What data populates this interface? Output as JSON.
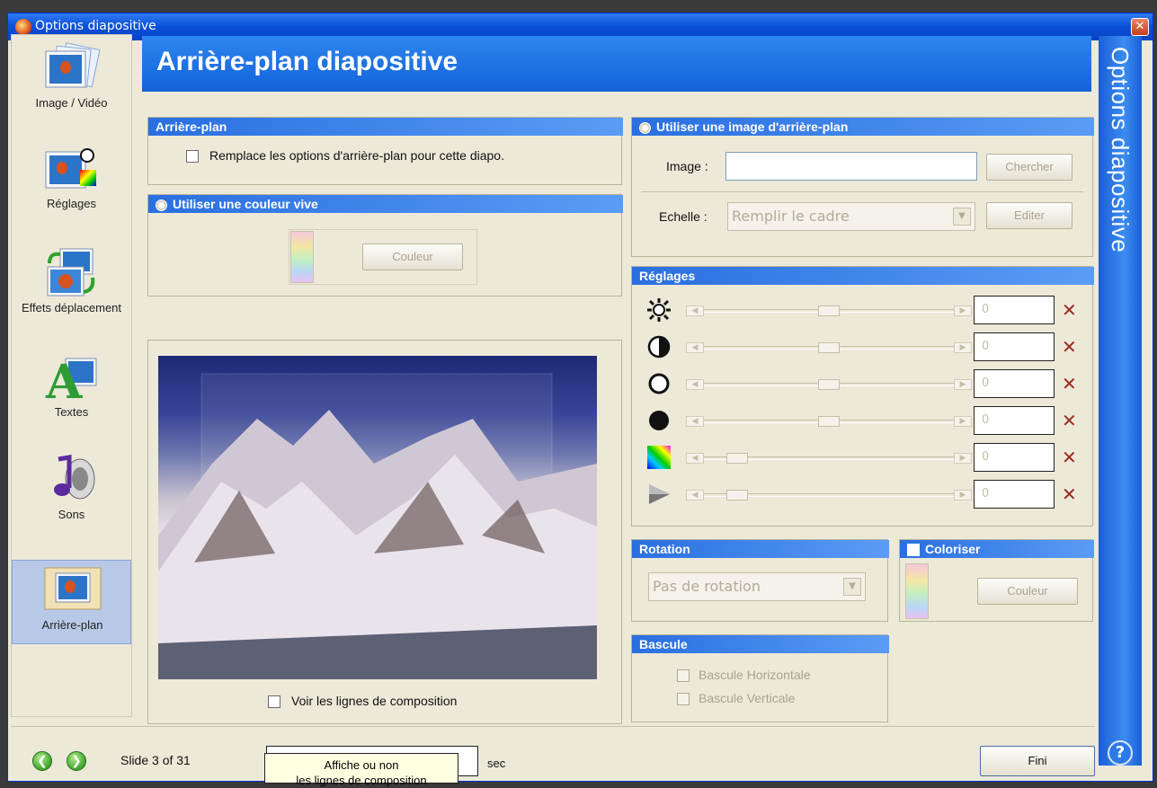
{
  "window": {
    "title": "Options diapositive",
    "close": "✕"
  },
  "header": {
    "title": "Arrière-plan diapositive"
  },
  "side_title": "Options diapositive",
  "help": "?",
  "sidebar": {
    "items": [
      {
        "label": "Image / Vidéo",
        "icon": "image-stack-icon"
      },
      {
        "label": "Réglages",
        "icon": "image-settings-icon"
      },
      {
        "label": "Effets déplacement",
        "icon": "motion-effects-icon"
      },
      {
        "label": "Textes",
        "icon": "text-letter-icon"
      },
      {
        "label": "Sons",
        "icon": "music-note-speaker-icon"
      },
      {
        "label": "Arrière-plan",
        "icon": "background-image-icon",
        "active": true
      }
    ]
  },
  "arriere_plan": {
    "title": "Arrière-plan",
    "override_label": "Remplace les options d'arrière-plan pour cette diapo.",
    "override_checked": false
  },
  "couleur_vive": {
    "title": "Utiliser une couleur vive",
    "button": "Couleur"
  },
  "image_bg": {
    "title": "Utiliser une image d'arrière-plan",
    "image_label": "Image :",
    "image_value": "",
    "browse_button": "Chercher",
    "scale_label": "Echelle :",
    "scale_value": "Remplir le cadre",
    "edit_button": "Editer"
  },
  "reglages": {
    "title": "Réglages",
    "rows": [
      {
        "icon": "brightness-icon",
        "value": "0",
        "position": 0.5
      },
      {
        "icon": "contrast-icon",
        "value": "0",
        "position": 0.5
      },
      {
        "icon": "white-point-icon",
        "value": "0",
        "position": 0.5
      },
      {
        "icon": "black-point-icon",
        "value": "0",
        "position": 0.5
      },
      {
        "icon": "color-spectrum-icon",
        "value": "0",
        "position": 0.1
      },
      {
        "icon": "transparency-icon",
        "value": "0",
        "position": 0.1
      }
    ],
    "reset": "✕"
  },
  "rotation": {
    "title": "Rotation",
    "value": "Pas de rotation"
  },
  "coloriser": {
    "title": "Coloriser",
    "button": "Couleur"
  },
  "bascule": {
    "title": "Bascule",
    "horizontal": "Bascule Horizontale",
    "vertical": "Bascule Verticale"
  },
  "preview": {
    "grid_label": "Voir les lignes de composition"
  },
  "footer": {
    "slide_text": "Slide 3 of 31",
    "duration_unit": "sec",
    "tooltip_line1": "Affiche ou non",
    "tooltip_line2": "les lignes de composition",
    "done_button": "Fini"
  }
}
